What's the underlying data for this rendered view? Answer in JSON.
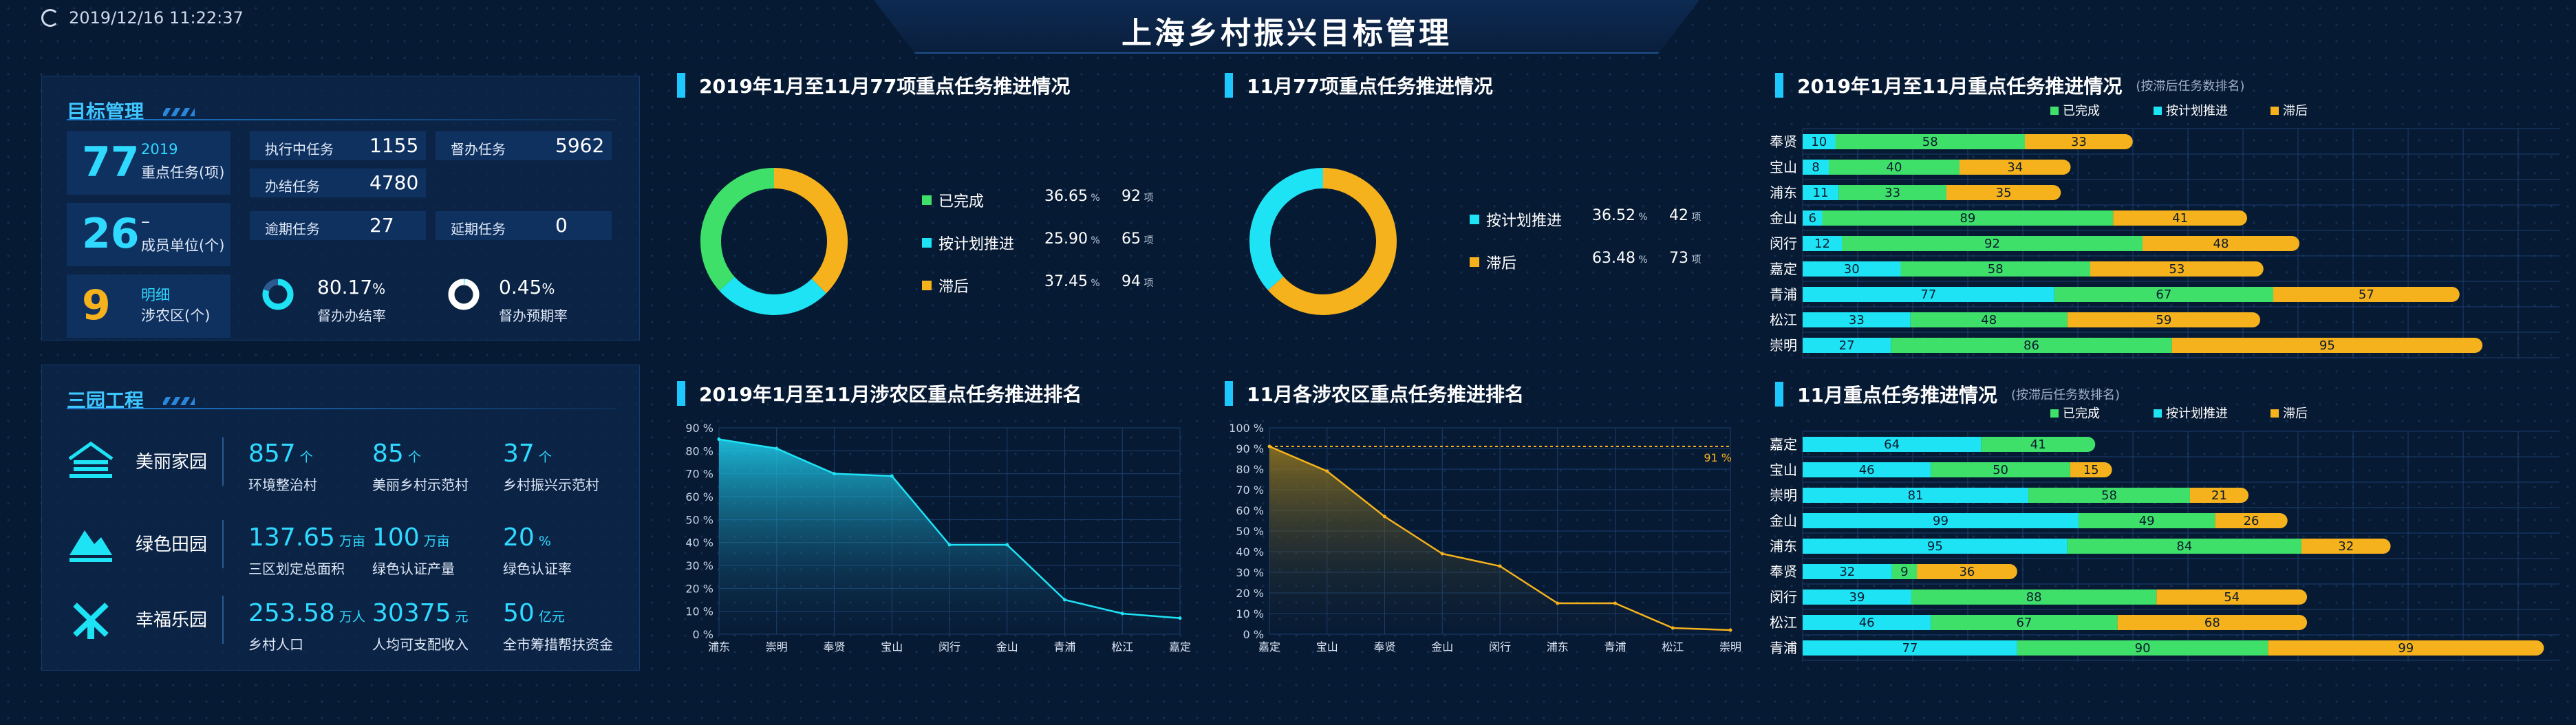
{
  "header": {
    "title": "上海乡村振兴目标管理",
    "datetime": "2019/12/16 11:22:37"
  },
  "goal": {
    "title": "目标管理",
    "tasks": {
      "num": "77",
      "year": "2019",
      "label": "重点任务(项)"
    },
    "units": {
      "num": "26",
      "dash": "–",
      "label": "成员单位(个)"
    },
    "districts": {
      "num": "9",
      "link": "明细",
      "label": "涉农区(个)"
    },
    "executing": {
      "label": "执行中任务",
      "value": "1155"
    },
    "supervising": {
      "label": "督办任务",
      "value": "5962"
    },
    "closed": {
      "label": "办结任务",
      "value": "4780"
    },
    "overdue": {
      "label": "逾期任务",
      "value": "27"
    },
    "extended": {
      "label": "延期任务",
      "value": "0"
    },
    "close_rate": {
      "value": "80.17",
      "unit": "%",
      "label": "督办办结率",
      "fraction": 0.8017
    },
    "warn_rate": {
      "value": "0.45",
      "unit": "%",
      "label": "督办预期率",
      "fraction": 0.0045
    }
  },
  "sanyuan": {
    "title": "三园工程",
    "rows": [
      {
        "name": "美丽家园",
        "icon": "house-icon",
        "items": [
          {
            "num": "857",
            "unit": "个",
            "desc": "环境整治村"
          },
          {
            "num": "85",
            "unit": "个",
            "desc": "美丽乡村示范村"
          },
          {
            "num": "37",
            "unit": "个",
            "desc": "乡村振兴示范村"
          }
        ]
      },
      {
        "name": "绿色田园",
        "icon": "field-icon",
        "items": [
          {
            "num": "137.65",
            "unit": "万亩",
            "desc": "三区划定总面积"
          },
          {
            "num": "100",
            "unit": "万亩",
            "desc": "绿色认证产量"
          },
          {
            "num": "20",
            "unit": "%",
            "desc": "绿色认证率"
          }
        ]
      },
      {
        "name": "幸福乐园",
        "icon": "windmill-icon",
        "items": [
          {
            "num": "253.58",
            "unit": "万人",
            "desc": "乡村人口"
          },
          {
            "num": "30375",
            "unit": "元",
            "desc": "人均可支配收入"
          },
          {
            "num": "50",
            "unit": "亿元",
            "desc": "全市筹措帮扶资金"
          }
        ]
      }
    ]
  },
  "donut1": {
    "title": "2019年1月至11月77项重点任务推进情况",
    "items": [
      {
        "label": "已完成",
        "pct": "36.65",
        "pct_unit": "%",
        "count": "92",
        "count_unit": "项",
        "value": 36.65,
        "color": "#3ee06a"
      },
      {
        "label": "按计划推进",
        "pct": "25.90",
        "pct_unit": "%",
        "count": "65",
        "count_unit": "项",
        "value": 25.9,
        "color": "#1ee3f5"
      },
      {
        "label": "滞后",
        "pct": "37.45",
        "pct_unit": "%",
        "count": "94",
        "count_unit": "项",
        "value": 37.45,
        "color": "#f5b21c"
      }
    ]
  },
  "donut2": {
    "title": "11月77项重点任务推进情况",
    "items": [
      {
        "label": "按计划推进",
        "pct": "36.52",
        "pct_unit": "%",
        "count": "42",
        "count_unit": "项",
        "value": 36.52,
        "color": "#1ee3f5"
      },
      {
        "label": "滞后",
        "pct": "63.48",
        "pct_unit": "%",
        "count": "73",
        "count_unit": "项",
        "value": 63.48,
        "color": "#f5b21c"
      }
    ]
  },
  "area1": {
    "title": "2019年1月至11月涉农区重点任务推进排名",
    "yticks": [
      "90 %",
      "80 %",
      "70 %",
      "60 %",
      "50 %",
      "40 %",
      "30 %",
      "20 %",
      "10 %",
      "0 %"
    ],
    "categories": [
      "浦东",
      "崇明",
      "奉贤",
      "宝山",
      "闵行",
      "金山",
      "青浦",
      "松江",
      "嘉定"
    ],
    "values": [
      85,
      81,
      70,
      69,
      39,
      39,
      15,
      9,
      7
    ]
  },
  "area2": {
    "title": "11月各涉农区重点任务推进排名",
    "yticks": [
      "100 %",
      "90 %",
      "80 %",
      "70 %",
      "60 %",
      "50 %",
      "40 %",
      "30 %",
      "20 %",
      "10 %",
      "0 %"
    ],
    "categories": [
      "嘉定",
      "宝山",
      "奉贤",
      "金山",
      "闵行",
      "浦东",
      "青浦",
      "松江",
      "崇明"
    ],
    "values": [
      91,
      79,
      57,
      39,
      33,
      15,
      15,
      3,
      2
    ],
    "target_label": "91 %"
  },
  "hbar1": {
    "title": "2019年1月至11月重点任务推进情况",
    "hint": "(按滞后任务数排名)",
    "legend": [
      {
        "label": "已完成",
        "color": "#3ee06a"
      },
      {
        "label": "按计划推进",
        "color": "#1ee3f5"
      },
      {
        "label": "滞后",
        "color": "#f5b21c"
      }
    ],
    "rows": [
      {
        "name": "奉贤",
        "plan": 10,
        "done": 58,
        "late": 33
      },
      {
        "name": "宝山",
        "plan": 8,
        "done": 40,
        "late": 34
      },
      {
        "name": "浦东",
        "plan": 11,
        "done": 33,
        "late": 35
      },
      {
        "name": "金山",
        "plan": 6,
        "done": 89,
        "late": 41
      },
      {
        "name": "闵行",
        "plan": 12,
        "done": 92,
        "late": 48
      },
      {
        "name": "嘉定",
        "plan": 30,
        "done": 58,
        "late": 53
      },
      {
        "name": "青浦",
        "plan": 77,
        "done": 67,
        "late": 57
      },
      {
        "name": "松江",
        "plan": 33,
        "done": 48,
        "late": 59
      },
      {
        "name": "崇明",
        "plan": 27,
        "done": 86,
        "late": 95
      }
    ]
  },
  "hbar2": {
    "title": "11月重点任务推进情况",
    "hint": "(按滞后任务数排名)",
    "legend": [
      {
        "label": "已完成",
        "color": "#3ee06a"
      },
      {
        "label": "按计划推进",
        "color": "#1ee3f5"
      },
      {
        "label": "滞后",
        "color": "#f5b21c"
      }
    ],
    "rows": [
      {
        "name": "嘉定",
        "plan": 64,
        "done": 41,
        "late": null
      },
      {
        "name": "宝山",
        "plan": 46,
        "done": 50,
        "late": 15
      },
      {
        "name": "崇明",
        "plan": 81,
        "done": 58,
        "late": 21
      },
      {
        "name": "金山",
        "plan": 99,
        "done": 49,
        "late": 26
      },
      {
        "name": "浦东",
        "plan": 95,
        "done": 84,
        "late": 32
      },
      {
        "name": "奉贤",
        "plan": 32,
        "done": 9,
        "late": 36
      },
      {
        "name": "闵行",
        "plan": 39,
        "done": 88,
        "late": 54
      },
      {
        "name": "松江",
        "plan": 46,
        "done": 67,
        "late": 68
      },
      {
        "name": "青浦",
        "plan": 77,
        "done": 90,
        "late": 99
      }
    ]
  }
}
